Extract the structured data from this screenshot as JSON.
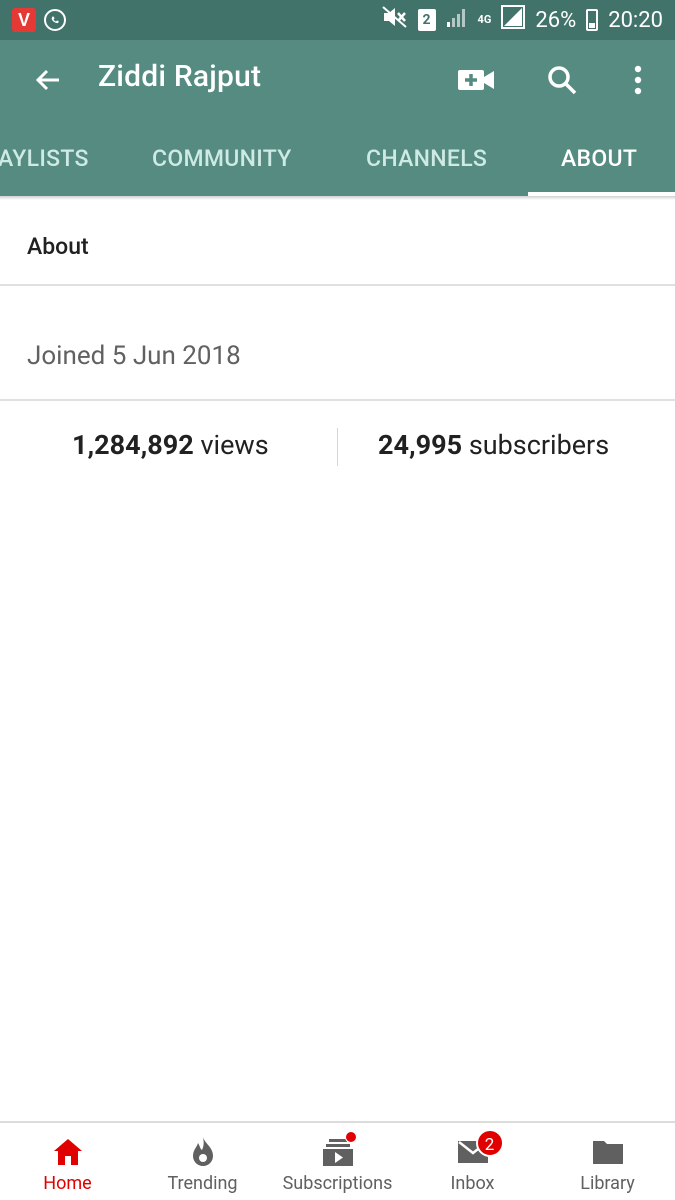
{
  "statusbar": {
    "app_letter": "V",
    "sim_slot": "2",
    "network": "4G",
    "battery": "26%",
    "time": "20:20"
  },
  "appbar": {
    "title": "Ziddi Rajput",
    "tabs": [
      {
        "label": "AYLISTS",
        "active": false
      },
      {
        "label": "COMMUNITY",
        "active": false
      },
      {
        "label": "CHANNELS",
        "active": false
      },
      {
        "label": "ABOUT",
        "active": true
      }
    ]
  },
  "about": {
    "heading": "About",
    "joined": "Joined 5 Jun 2018",
    "views_count": "1,284,892",
    "views_label": "views",
    "subscribers_count": "24,995",
    "subscribers_label": "subscribers"
  },
  "bottom_nav": {
    "items": [
      {
        "label": "Home",
        "icon": "home-icon",
        "active": true
      },
      {
        "label": "Trending",
        "icon": "trending-icon",
        "active": false
      },
      {
        "label": "Subscriptions",
        "icon": "subscriptions-icon",
        "active": false
      },
      {
        "label": "Inbox",
        "icon": "inbox-icon",
        "active": false,
        "badge": "2"
      },
      {
        "label": "Library",
        "icon": "library-icon",
        "active": false
      }
    ]
  },
  "colors": {
    "status_bar": "#42736b",
    "app_bar": "#558b80",
    "active_nav": "#e00000"
  }
}
